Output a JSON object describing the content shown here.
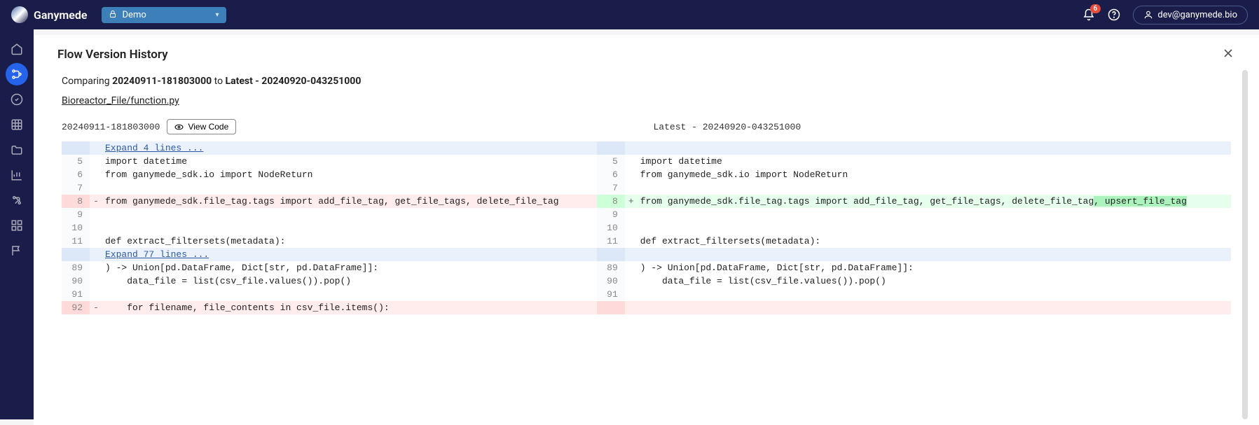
{
  "brand": "Ganymede",
  "env": {
    "label": "Demo"
  },
  "notifications": {
    "count": "6"
  },
  "user": {
    "email": "dev@ganymede.bio"
  },
  "panel": {
    "title": "Flow Version History",
    "compare_prefix": "Comparing ",
    "from_version": "20240911-181803000",
    "to_word": " to ",
    "to_version": "Latest - 20240920-043251000",
    "file_path": "Bioreactor_File/function.py"
  },
  "diff_header": {
    "left_label": "20240911-181803000",
    "view_code": "View Code",
    "right_label": "Latest - 20240920-043251000"
  },
  "diff": {
    "expand1": "Expand 4 lines ...",
    "expand2": "Expand 77 lines ...",
    "rows": [
      {
        "ln_l": "5",
        "ml": " ",
        "cl": "import datetime",
        "ln_r": "5",
        "mr": " ",
        "cr": "import datetime"
      },
      {
        "ln_l": "6",
        "ml": " ",
        "cl": "from ganymede_sdk.io import NodeReturn",
        "ln_r": "6",
        "mr": " ",
        "cr": "from ganymede_sdk.io import NodeReturn"
      },
      {
        "ln_l": "7",
        "ml": " ",
        "cl": "",
        "ln_r": "7",
        "mr": " ",
        "cr": ""
      },
      {
        "ln_l": "8",
        "ml": "-",
        "cl": "from ganymede_sdk.file_tag.tags import add_file_tag, get_file_tags, delete_file_tag",
        "ln_r": "8",
        "mr": "+",
        "cr": "from ganymede_sdk.file_tag.tags import add_file_tag, get_file_tags, delete_file_tag",
        "cr_extra": ", upsert_file_tag"
      },
      {
        "ln_l": "9",
        "ml": " ",
        "cl": "",
        "ln_r": "9",
        "mr": " ",
        "cr": ""
      },
      {
        "ln_l": "10",
        "ml": " ",
        "cl": "",
        "ln_r": "10",
        "mr": " ",
        "cr": ""
      },
      {
        "ln_l": "11",
        "ml": " ",
        "cl": "def extract_filtersets(metadata):",
        "ln_r": "11",
        "mr": " ",
        "cr": "def extract_filtersets(metadata):"
      },
      {
        "ln_l": "89",
        "ml": " ",
        "cl": ") -> Union[pd.DataFrame, Dict[str, pd.DataFrame]]:",
        "ln_r": "89",
        "mr": " ",
        "cr": ") -> Union[pd.DataFrame, Dict[str, pd.DataFrame]]:"
      },
      {
        "ln_l": "90",
        "ml": " ",
        "cl": "    data_file = list(csv_file.values()).pop()",
        "ln_r": "90",
        "mr": " ",
        "cr": "    data_file = list(csv_file.values()).pop()"
      },
      {
        "ln_l": "91",
        "ml": " ",
        "cl": "",
        "ln_r": "91",
        "mr": " ",
        "cr": ""
      },
      {
        "ln_l": "92",
        "ml": "-",
        "cl": "    for filename, file_contents in csv_file.items():",
        "ln_r": "",
        "mr": " ",
        "cr": ""
      }
    ]
  }
}
